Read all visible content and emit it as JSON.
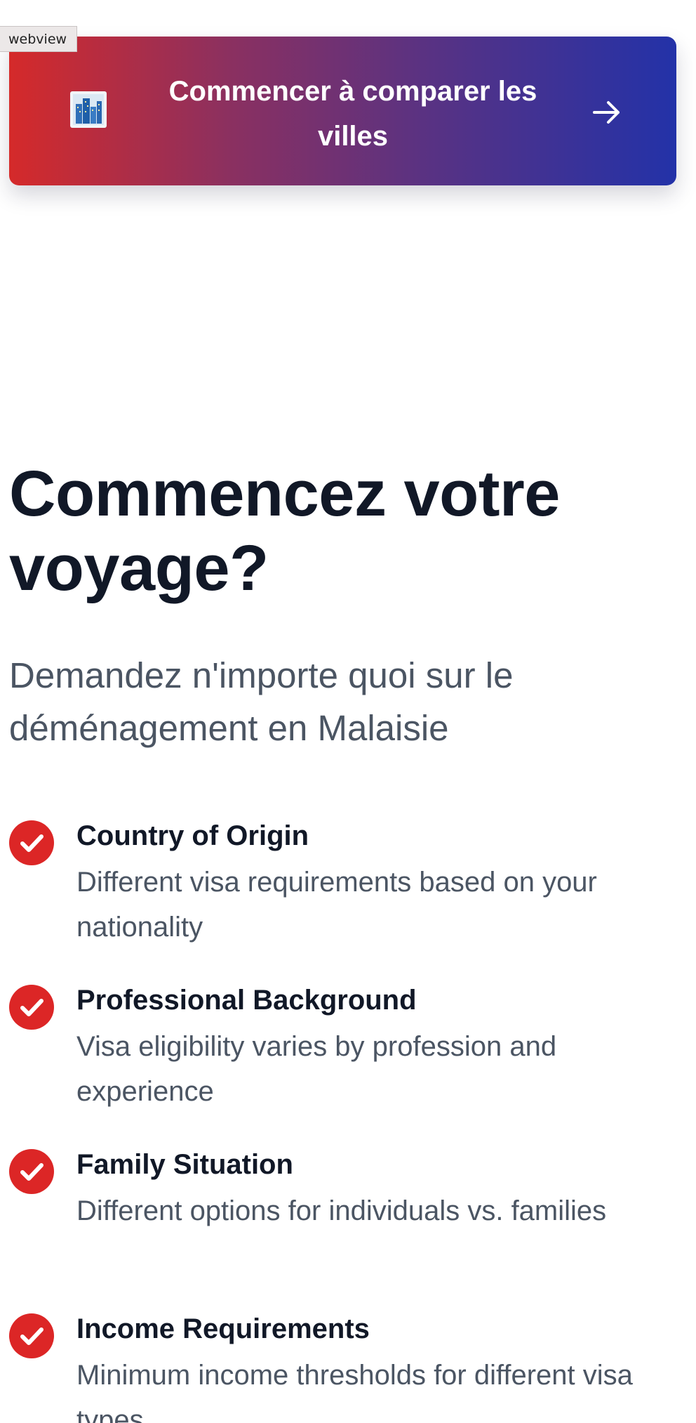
{
  "webview_tag": "webview",
  "cta": {
    "label": "Commencer à comparer les villes",
    "icon": "cityscape-icon",
    "arrow_icon": "arrow-right-icon"
  },
  "hero": {
    "title": "Commencez votre voyage?",
    "subtitle": "Demandez n'importe quoi sur le déménagement en Malaisie"
  },
  "features": [
    {
      "title": "Country of Origin",
      "description": "Different visa requirements based on your nationality"
    },
    {
      "title": "Professional Background",
      "description": "Visa eligibility varies by profession and experience"
    },
    {
      "title": "Family Situation",
      "description": "Different options for individuals vs. families"
    },
    {
      "title": "Income Requirements",
      "description": "Minimum income thresholds for different visa types"
    }
  ],
  "colors": {
    "gradient_start": "#d52a2a",
    "gradient_end": "#2332a8",
    "check_red": "#dc2626",
    "heading": "#111827",
    "body_text": "#4b5563"
  }
}
